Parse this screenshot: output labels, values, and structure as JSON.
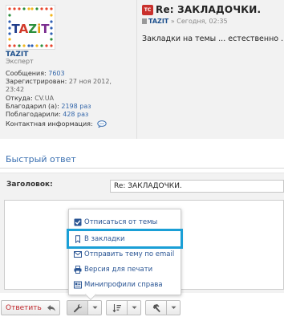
{
  "post": {
    "user": {
      "avatar_text": "TAZIT",
      "username": "TAZIT",
      "rank": "Эксперт",
      "stats": {
        "messages_label": "Сообщения:",
        "messages_value": "7603",
        "registered_label": "Зарегистрирован:",
        "registered_value_1": "27 ноя 2012,",
        "registered_value_2": "23:42",
        "from_label": "Откуда:",
        "from_value": "CV.UA",
        "thanked_label": "Благодарил (а):",
        "thanked_value": "2198 раз",
        "was_thanked_label": "Поблагодарили:",
        "was_thanked_value": "428 раз",
        "contact_label": "Контактная информация:"
      }
    },
    "header": {
      "icon_text": "TC",
      "title": "Re: ЗАКЛАДОЧКИ.",
      "author": "TAZIT",
      "meta_rest": "» Сегодня, 02:35"
    },
    "body": "Закладки на темы ... естественно ."
  },
  "quick_reply": {
    "title": "Быстрый ответ",
    "subject_label": "Заголовок:",
    "subject_value": "Re: ЗАКЛАДОЧКИ."
  },
  "dropdown": {
    "items": [
      {
        "label": "Отписаться от темы",
        "icon": "checkbox-icon"
      },
      {
        "label": "В закладки",
        "icon": "bookmark-icon"
      },
      {
        "label": "Отправить тему по email",
        "icon": "email-icon"
      },
      {
        "label": "Версия для печати",
        "icon": "printer-icon"
      },
      {
        "label": "Минипрофили справа",
        "icon": "profile-card-icon"
      }
    ],
    "highlight_color": "#1a9fd6"
  },
  "toolbar": {
    "reply_label": "Ответить",
    "reply_color": "#c0262b",
    "tools_icon": "wrench-icon",
    "sort_icon": "sort-icon",
    "moderation_icon": "hammer-icon"
  },
  "colors": {
    "link": "#3366aa",
    "heading_blue": "#3a6fb0",
    "panel_bg": "#f2f2f2"
  }
}
